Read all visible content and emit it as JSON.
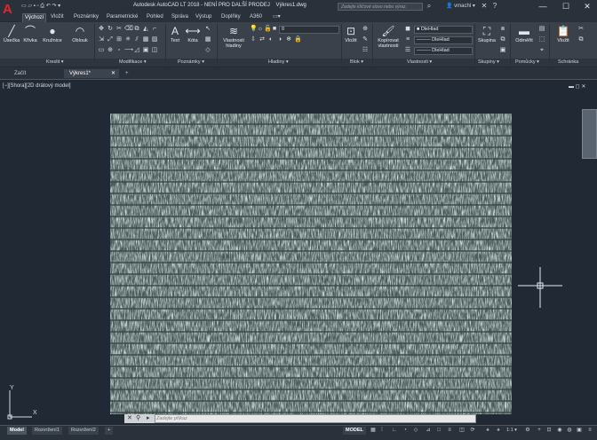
{
  "app": {
    "title": "Autodesk AutoCAD LT 2018 - NENÍ PRO DALŠÍ PRODEJ",
    "filename": "Výkres1.dwg",
    "search_placeholder": "Zadejte klíčové slovo nebo výraz.",
    "user": "vmachl"
  },
  "ribbon_tabs": [
    "Výchozí",
    "Vložit",
    "Poznámky",
    "Parametrické",
    "Pohled",
    "Správa",
    "Výstup",
    "Doplňky",
    "A360"
  ],
  "ribbon": {
    "draw": {
      "title": "Kreslit",
      "line": "Úsečka",
      "polyline": "Křivka",
      "circle": "Kružnice",
      "arc": "Oblouk"
    },
    "modify": {
      "title": "Modifikace"
    },
    "annotation": {
      "title": "Poznámky",
      "text": "Text",
      "dimension": "Kóta"
    },
    "layers": {
      "title": "Hladiny",
      "layer_props": "Vlastnosti hladiny",
      "current_layer": "0"
    },
    "block": {
      "title": "Blok",
      "insert": "Vložit"
    },
    "properties": {
      "title": "Vlastnosti",
      "match": "Kopírovat vlastnosti",
      "color": "DleHlad",
      "linetype": "DleHlad",
      "lineweight": "DleHlad"
    },
    "groups": {
      "title": "Skupiny",
      "group": "Skupina"
    },
    "utilities": {
      "title": "Pomůcky",
      "measure": "Odměřit"
    },
    "clipboard": {
      "title": "Schránka",
      "paste": "Vložit"
    }
  },
  "doc_tabs": [
    {
      "label": "Začít"
    },
    {
      "label": "Výkres1*"
    }
  ],
  "command_line": {
    "placeholder": "Zadejte příkaz"
  },
  "ucs": {
    "x": "X",
    "y": "Y"
  },
  "status": {
    "layout_tabs": [
      "Model",
      "Rozvržení1",
      "Rozvržení2"
    ],
    "model_label": "MODEL",
    "scale": "1:1"
  }
}
